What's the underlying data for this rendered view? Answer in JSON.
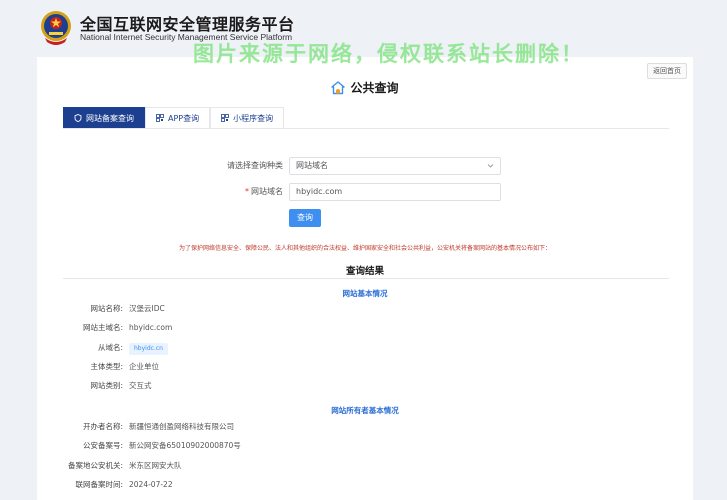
{
  "header": {
    "title": "全国互联网安全管理服务平台",
    "subtitle": "National Internet Security Management Service Platform",
    "watermark": "图片来源于网络，侵权联系站长删除！"
  },
  "panel": {
    "back_label": "返回首页",
    "page_title": "公共查询",
    "tabs": [
      {
        "label": "网站备案查询",
        "icon": "shield-icon",
        "active": true
      },
      {
        "label": "APP查询",
        "icon": "qr-icon",
        "active": false
      },
      {
        "label": "小程序查询",
        "icon": "qr-icon",
        "active": false
      }
    ]
  },
  "form": {
    "type_label": "请选择查询种类",
    "type_value": "网站域名",
    "domain_label": "网站域名",
    "domain_required_mark": "*",
    "domain_value": "hbyidc.com",
    "submit_label": "查询"
  },
  "notice": "为了保护网络信息安全、保障公民、法人和其他组织的合法权益、维护国家安全和社会公共利益，公安机关将备案网站的基本情况公布如下：",
  "result": {
    "title": "查询结果",
    "basic_section_title": "网站基本情况",
    "basic": [
      {
        "label": "网站名称:",
        "value": "汉堡云IDC"
      },
      {
        "label": "网站主域名:",
        "value": "hbyidc.com"
      },
      {
        "label": "从域名:",
        "value": "hbyidc.cn",
        "tag": true
      },
      {
        "label": "主体类型:",
        "value": "企业单位"
      },
      {
        "label": "网站类别:",
        "value": "交互式"
      }
    ],
    "owner_section_title": "网站所有者基本情况",
    "owner": [
      {
        "label": "开办者名称:",
        "value": "新疆恒通创盈网络科技有限公司"
      },
      {
        "label": "公安备案号:",
        "value": "新公网安备65010902000870号"
      },
      {
        "label": "备案地公安机关:",
        "value": "米东区网安大队"
      },
      {
        "label": "联网备案时间:",
        "value": "2024-07-22"
      }
    ]
  },
  "colors": {
    "brand_blue": "#1d3f8f",
    "button_blue": "#3e8ff0",
    "notice_red": "#c0392b",
    "section_blue": "#2b6fd6",
    "watermark_green": "#78e178"
  }
}
